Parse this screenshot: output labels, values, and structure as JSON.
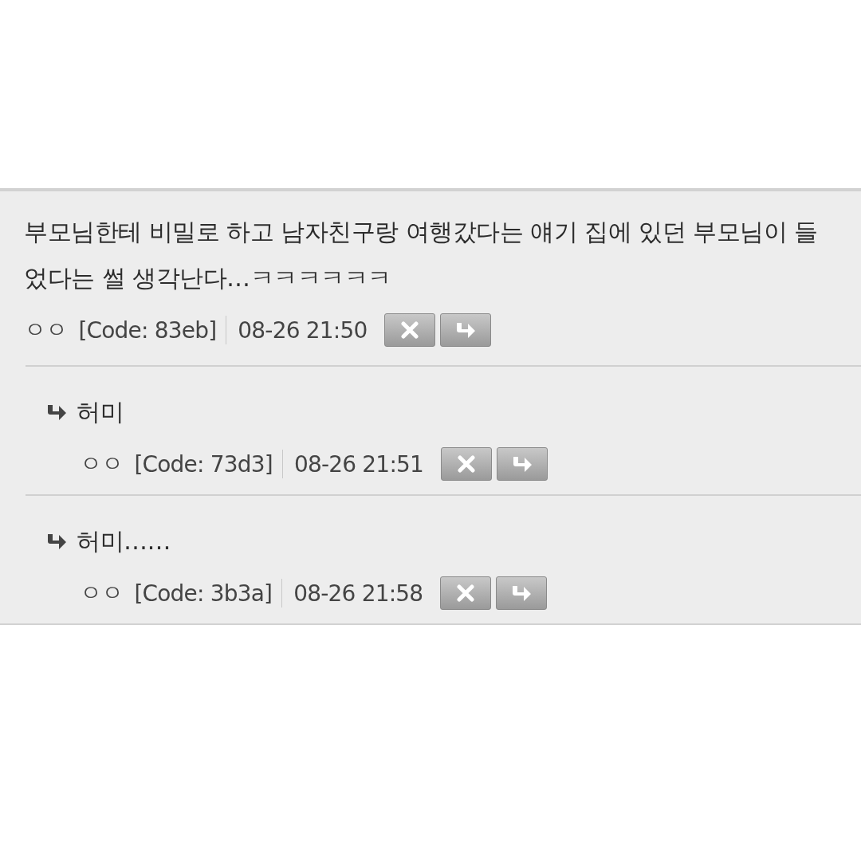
{
  "comment": {
    "text": "부모님한테 비밀로 하고 남자친구랑 여행갔다는 얘기 집에 있던 부모님이 들었다는 썰 생각난다…ㅋㅋㅋㅋㅋㅋ",
    "author": "ㅇㅇ",
    "code": "[Code: 83eb]",
    "time": "08-26 21:50"
  },
  "replies": [
    {
      "text": "허미",
      "author": "ㅇㅇ",
      "code": "[Code: 73d3]",
      "time": "08-26 21:51"
    },
    {
      "text": "허미……",
      "author": "ㅇㅇ",
      "code": "[Code: 3b3a]",
      "time": "08-26 21:58"
    }
  ]
}
